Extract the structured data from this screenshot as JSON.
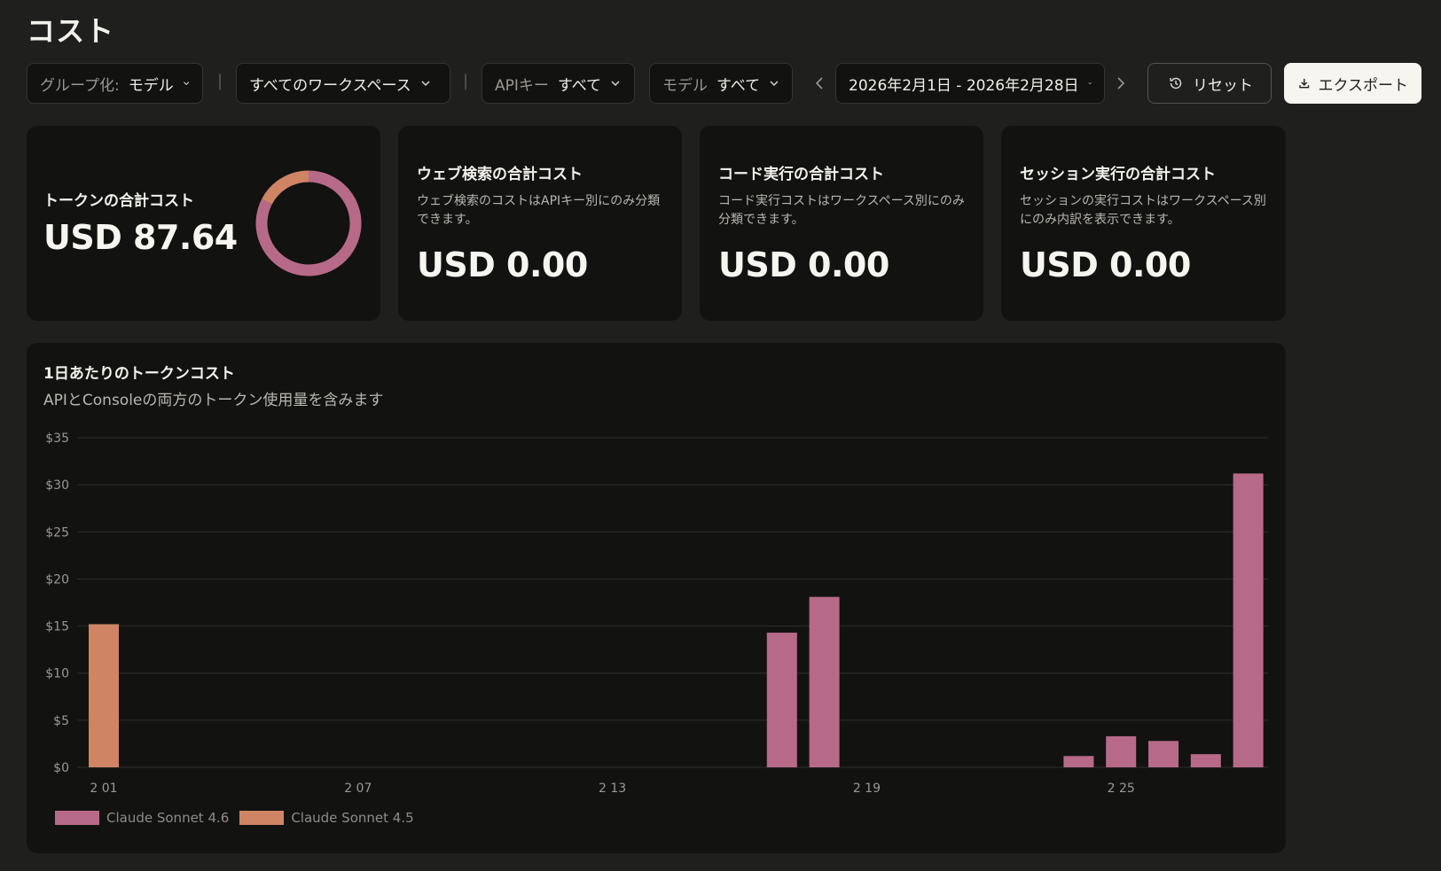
{
  "page": {
    "title": "コスト"
  },
  "toolbar": {
    "group_by_label": "グループ化:",
    "group_by_value": "モデル",
    "separator": "|",
    "workspace_value": "すべてのワークスペース",
    "apikey_label": "APIキー",
    "apikey_value": "すべて",
    "model_label": "モデル",
    "model_value": "すべて",
    "date_range": "2026年2月1日 - 2026年2月28日",
    "reset_label": "リセット",
    "export_label": "エクスポート"
  },
  "cards": {
    "tokens": {
      "title": "トークンの合計コスト",
      "value": "USD 87.64"
    },
    "web_search": {
      "title": "ウェブ検索の合計コスト",
      "desc": "ウェブ検索のコストはAPIキー別にのみ分類できます。",
      "value": "USD 0.00"
    },
    "code_exec": {
      "title": "コード実行の合計コスト",
      "desc": "コード実行コストはワークスペース別にのみ分類できます。",
      "value": "USD 0.00"
    },
    "session_exec": {
      "title": "セッション実行の合計コスト",
      "desc": "セッションの実行コストはワークスペース別にのみ内訳を表示できます。",
      "value": "USD 0.00"
    }
  },
  "donut": {
    "segments": [
      {
        "name": "Claude Sonnet 4.6",
        "value": 72.39
      },
      {
        "name": "Claude Sonnet 4.5",
        "value": 15.25
      }
    ]
  },
  "colors": {
    "sonnet46": "#b76a87",
    "sonnet45": "#cf8464",
    "grid": "#2f2f2d",
    "tick": "#9a9893"
  },
  "chart_data": {
    "type": "bar",
    "title": "1日あたりのトークンコスト",
    "subtitle": "APIとConsoleの両方のトークン使用量を含みます",
    "x_tick_labels": [
      "2 01",
      "2 07",
      "2 13",
      "2 19",
      "2 25"
    ],
    "x_tick_days": [
      1,
      7,
      13,
      19,
      25
    ],
    "y_ticks": [
      "$0",
      "$5",
      "$10",
      "$15",
      "$20",
      "$25",
      "$30",
      "$35"
    ],
    "ylim": [
      0,
      35
    ],
    "days": [
      1,
      2,
      3,
      4,
      5,
      6,
      7,
      8,
      9,
      10,
      11,
      12,
      13,
      14,
      15,
      16,
      17,
      18,
      19,
      20,
      21,
      22,
      23,
      24,
      25,
      26,
      27,
      28
    ],
    "series": [
      {
        "name": "Claude Sonnet 4.6",
        "color": "#b76a87",
        "values": [
          0,
          0,
          0,
          0,
          0,
          0,
          0,
          0,
          0,
          0,
          0,
          0,
          0,
          0,
          0,
          0,
          14.3,
          18.1,
          0,
          0,
          0,
          0,
          0,
          1.2,
          3.3,
          2.8,
          1.4,
          31.2
        ]
      },
      {
        "name": "Claude Sonnet 4.5",
        "color": "#cf8464",
        "values": [
          15.2,
          0,
          0,
          0,
          0,
          0,
          0,
          0,
          0,
          0,
          0,
          0,
          0,
          0,
          0,
          0,
          0,
          0,
          0,
          0,
          0,
          0,
          0,
          0,
          0,
          0,
          0,
          0
        ]
      }
    ],
    "legend_position": "bottom-left",
    "grid": true
  }
}
